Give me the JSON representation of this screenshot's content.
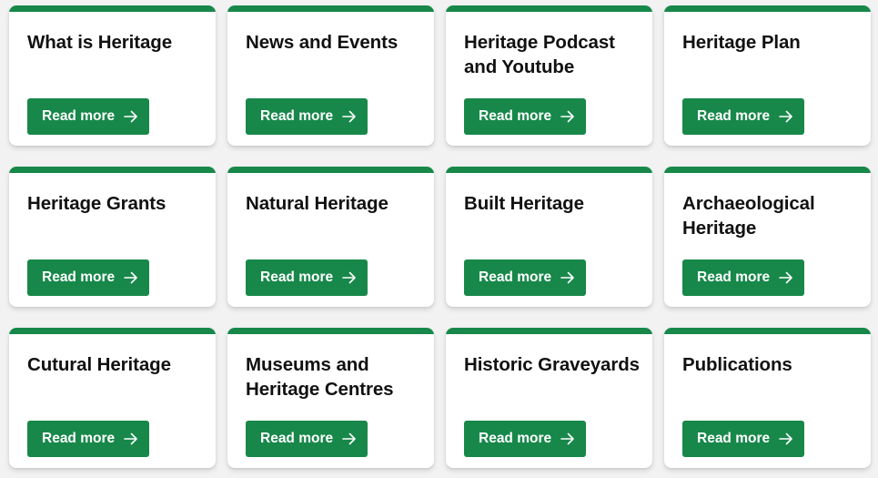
{
  "colors": {
    "accent": "#17884a",
    "background": "#f2f2f2",
    "card": "#ffffff",
    "title_text": "#111111",
    "button_text": "#ffffff"
  },
  "cards": [
    {
      "title": "What is Heritage",
      "button_label": "Read more",
      "icon": "arrow-right-icon"
    },
    {
      "title": "News and Events",
      "button_label": "Read more",
      "icon": "arrow-right-icon"
    },
    {
      "title": "Heritage Podcast and Youtube",
      "button_label": "Read more",
      "icon": "arrow-right-icon"
    },
    {
      "title": "Heritage Plan",
      "button_label": "Read more",
      "icon": "arrow-right-icon"
    },
    {
      "title": "Heritage Grants",
      "button_label": "Read more",
      "icon": "arrow-right-icon"
    },
    {
      "title": "Natural Heritage",
      "button_label": "Read more",
      "icon": "arrow-right-icon"
    },
    {
      "title": "Built Heritage",
      "button_label": "Read more",
      "icon": "arrow-right-icon"
    },
    {
      "title": "Archaeological Heritage",
      "button_label": "Read more",
      "icon": "arrow-right-icon"
    },
    {
      "title": "Cutural Heritage",
      "button_label": "Read more",
      "icon": "arrow-right-icon"
    },
    {
      "title": "Museums and Heritage Centres",
      "button_label": "Read more",
      "icon": "arrow-right-icon"
    },
    {
      "title": "Historic Graveyards",
      "button_label": "Read more",
      "icon": "arrow-right-icon"
    },
    {
      "title": "Publications",
      "button_label": "Read more",
      "icon": "arrow-right-icon"
    }
  ]
}
